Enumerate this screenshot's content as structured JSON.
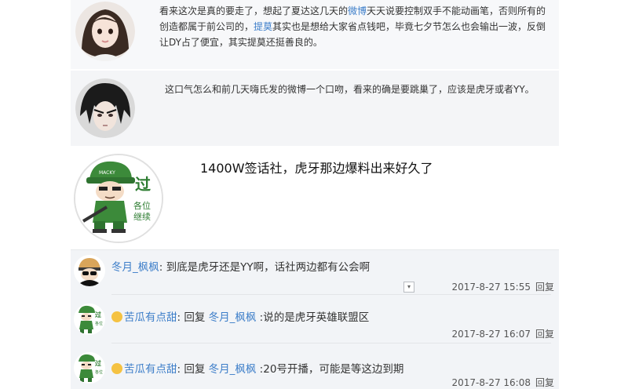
{
  "comments": [
    {
      "text_a": "看来这次是真的要走了，想起了夏达这几天的",
      "link_a": "微博",
      "text_b": "天天说要控制双手不能动画笔，否则所有的创造都属于前公司的，",
      "link_b": "提莫",
      "text_c": "其实也是想给大家省点钱吧，毕竟七夕节怎么也会输出一波，反倒让DY占了便宜，其实提莫还挺善良的。"
    },
    {
      "text": "这口气怎么和前几天嗨氏发的微博一个口吻，看来的确是要跳巢了，应该是虎牙或者YY。"
    },
    {
      "text": "1400W签话社，虎牙那边爆料出来好久了",
      "avatar_text": "各位继续",
      "avatar_badge": "过",
      "avatar_cap": "MACKY"
    }
  ],
  "replies": [
    {
      "username": "冬月_枫枫",
      "text": ": 到底是虎牙还是YY啊，话社两边都有公会啊",
      "timestamp": "2017-8-27 15:55",
      "reply_label": "回复",
      "dropdown_icon": "▾"
    },
    {
      "username": "苦瓜有点甜",
      "reply_prefix": ": 回复 ",
      "reply_to": "冬月_枫枫",
      "text": " :说的是虎牙英雄联盟区",
      "timestamp": "2017-8-27 16:07",
      "reply_label": "回复"
    },
    {
      "username": "苦瓜有点甜",
      "reply_prefix": ": 回复 ",
      "reply_to": "冬月_枫枫",
      "text": " :20号开播，可能是等这边到期",
      "timestamp": "2017-8-27 16:08",
      "reply_label": "回复"
    }
  ],
  "colors": {
    "link": "#3d7ec9",
    "reply_bg": "#f2f4f7",
    "avatar_green": "#3c8a3a"
  }
}
